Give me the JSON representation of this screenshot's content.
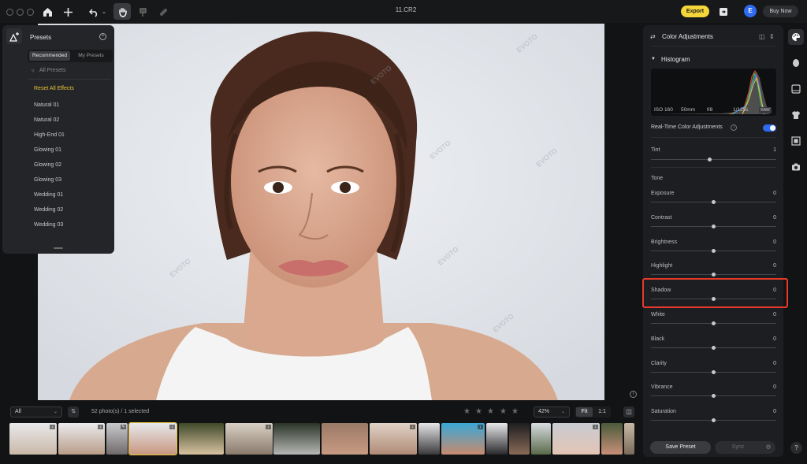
{
  "window": {
    "title": "11.CR2"
  },
  "toolbar": {
    "export_label": "Export",
    "avatar_letter": "E",
    "buy_label": "Buy Now"
  },
  "presets": {
    "title": "Presets",
    "tabs": [
      "Recommended",
      "My Presets"
    ],
    "filter_label": "All Presets",
    "reset_label": "Reset All Effects",
    "items": [
      "Natural 01",
      "Natural 02",
      "High-End 01",
      "Glowing 01",
      "Glowing 02",
      "Glowing 03",
      "Wedding 01",
      "Wedding 02",
      "Wedding 03"
    ]
  },
  "watermark": "EVOTO",
  "filmstrip": {
    "filter_value": "All",
    "count_text": "52 photo(s) / 1 selected",
    "zoom_value": "42%",
    "fit_label": "Fit",
    "one_to_one_label": "1:1",
    "rating_stars": 5
  },
  "adjust": {
    "title": "Color Adjustments",
    "histogram_label": "Histogram",
    "meta": {
      "iso": "ISO 160",
      "focal": "50mm",
      "aperture": "f/8",
      "shutter": "1/125s",
      "raw": "RAW"
    },
    "realtime_label": "Real-Time Color Adjustments",
    "realtime_on": true,
    "tint_label": "Tint",
    "tint_value": "1",
    "tone_label": "Tone",
    "sliders": [
      {
        "label": "Exposure",
        "value": "0"
      },
      {
        "label": "Contrast",
        "value": "0"
      },
      {
        "label": "Brightness",
        "value": "0"
      },
      {
        "label": "Highlight",
        "value": "0"
      },
      {
        "label": "Shadow",
        "value": "0"
      },
      {
        "label": "White",
        "value": "0"
      },
      {
        "label": "Black",
        "value": "0"
      },
      {
        "label": "Clarity",
        "value": "0"
      },
      {
        "label": "Vibrance",
        "value": "0"
      },
      {
        "label": "Saturation",
        "value": "0"
      }
    ],
    "save_preset_label": "Save Preset",
    "sync_label": "Sync"
  },
  "help_label": "?",
  "colors": {
    "accent_yellow": "#f5d63a",
    "accent_blue": "#2f6bf0",
    "highlight_red": "#e53a2a"
  }
}
